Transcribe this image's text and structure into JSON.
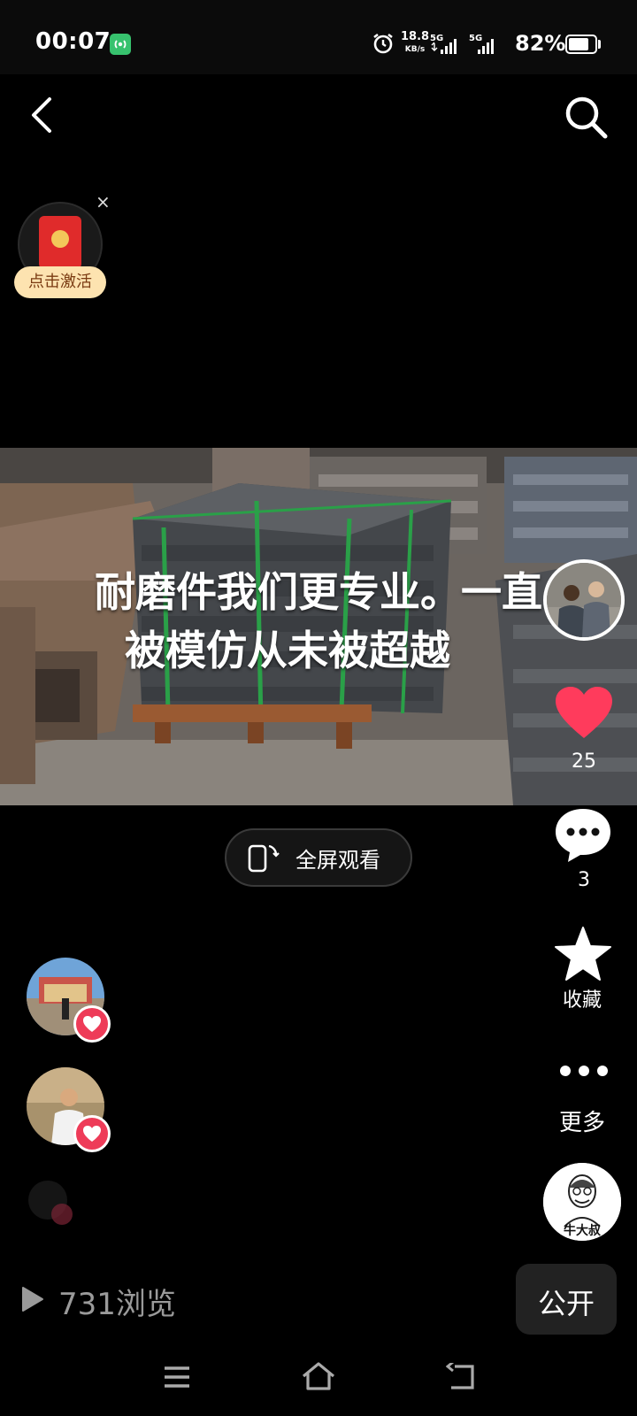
{
  "status_bar": {
    "time": "00:07",
    "net_speed_value": "18.8",
    "net_speed_unit": "KB/s",
    "sim1_type": "5G",
    "sim2_type": "5G",
    "battery_percent": "82%",
    "battery_level": 0.82
  },
  "red_packet": {
    "label": "点击激活",
    "close": "×"
  },
  "video": {
    "caption_line_1": "耐磨件我们更专业。一直",
    "caption_line_2": "被模仿从未被超越"
  },
  "fullscreen": {
    "label": "全屏观看"
  },
  "side_rail": {
    "like_count": "25",
    "comment_count": "3",
    "favorite_label": "收藏",
    "more_label": "更多",
    "profile_avatar_text": "牛大叔"
  },
  "bottom": {
    "views_label": "731浏览",
    "public_label": "公开"
  },
  "colors": {
    "background": "#000000",
    "like_red": "#ff3b5c",
    "liker_heart": "#ee3b58",
    "red_packet_label_bg": "#fde3b0",
    "signal_app_green": "#37c26e"
  },
  "icons": {
    "back": "chevron-left-icon",
    "search": "search-icon",
    "like": "heart-icon",
    "comment": "speech-bubble-icon",
    "favorite": "star-icon",
    "more": "ellipsis-icon",
    "views": "play-icon",
    "fullscreen": "rotate-phone-icon"
  }
}
